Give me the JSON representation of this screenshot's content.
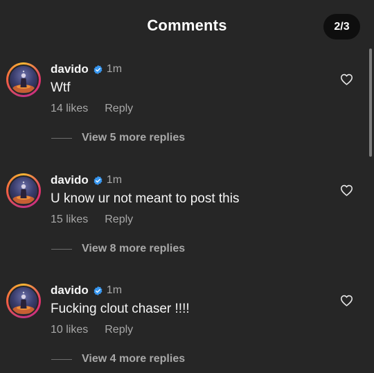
{
  "header": {
    "title": "Comments",
    "page_indicator": "2/3"
  },
  "comments": [
    {
      "username": "davido",
      "verified": true,
      "time": "1m",
      "text": "Wtf",
      "likes": "14 likes",
      "reply_label": "Reply",
      "view_replies": "View 5 more replies"
    },
    {
      "username": "davido",
      "verified": true,
      "time": "1m",
      "text": "U know ur not meant to post this",
      "likes": "15 likes",
      "reply_label": "Reply",
      "view_replies": "View 8 more replies"
    },
    {
      "username": "davido",
      "verified": true,
      "time": "1m",
      "text": "Fucking clout chaser !!!!",
      "likes": "10 likes",
      "reply_label": "Reply",
      "view_replies": "View 4 more replies"
    }
  ],
  "colors": {
    "background": "#262626",
    "verified_badge": "#3897f0",
    "secondary_text": "#a8a8a8",
    "primary_text": "#f5f5f5"
  },
  "icons": {
    "verified": "verified-badge-icon",
    "like": "heart-outline-icon"
  }
}
